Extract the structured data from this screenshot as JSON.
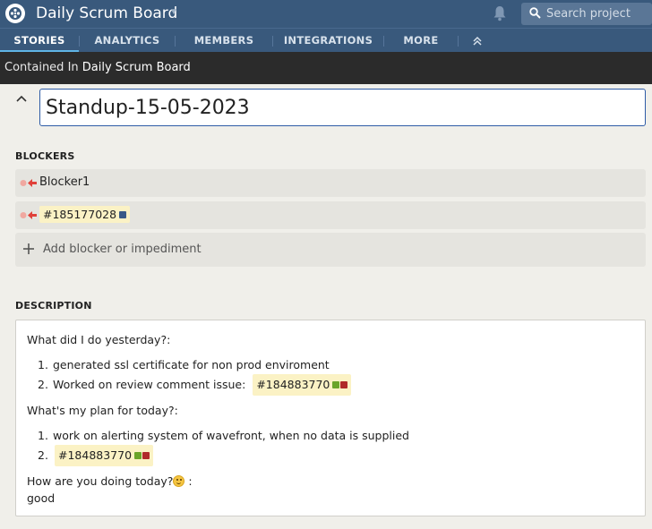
{
  "header": {
    "project_title": "Daily Scrum Board",
    "search_placeholder": "Search project",
    "icons": [
      "tracker-logo-icon",
      "chevron-down-icon",
      "bell-icon",
      "search-icon"
    ]
  },
  "nav": {
    "tabs": [
      {
        "label": "STORIES",
        "active": true
      },
      {
        "label": "ANALYTICS",
        "active": false
      },
      {
        "label": "MEMBERS",
        "active": false
      },
      {
        "label": "INTEGRATIONS",
        "active": false
      },
      {
        "label": "MORE",
        "active": false
      }
    ]
  },
  "breadcrumb": {
    "label": "Contained In",
    "link": "Daily Scrum Board"
  },
  "story": {
    "title": "Standup-15-05-2023"
  },
  "blockers": {
    "heading": "BLOCKERS",
    "items": [
      {
        "text": "Blocker1"
      },
      {
        "text": "#185177028",
        "status_colors": [
          "#3a5a86"
        ]
      }
    ],
    "add_label": "Add blocker or impediment"
  },
  "description": {
    "heading": "DESCRIPTION",
    "q1": "What did I do yesterday?:",
    "yesterday": [
      {
        "num": "1.",
        "text": "generated ssl certificate for non prod enviroment"
      },
      {
        "num": "2.",
        "text": "Worked on review comment issue:",
        "ref": "#184883770"
      }
    ],
    "q2": "What's my plan for today?:",
    "today": [
      {
        "num": "1.",
        "text": "work on alerting system of wavefront, when no data is supplied"
      },
      {
        "num": "2.",
        "ref": "#184883770"
      }
    ],
    "q3": "How are you doing today?",
    "q3_suffix": " :",
    "answer": "good",
    "ref_colors": [
      "#6aa52a",
      "#b02a2a"
    ]
  },
  "colors": {
    "header_bg": "#39597c",
    "active_tab_underline": "#5fb4e6",
    "breadcrumb_bg": "#2b2b2b",
    "title_border": "#2e5ca6",
    "chip_bg": "#fbf2c5",
    "blocker_arrow": "#e0413a"
  }
}
